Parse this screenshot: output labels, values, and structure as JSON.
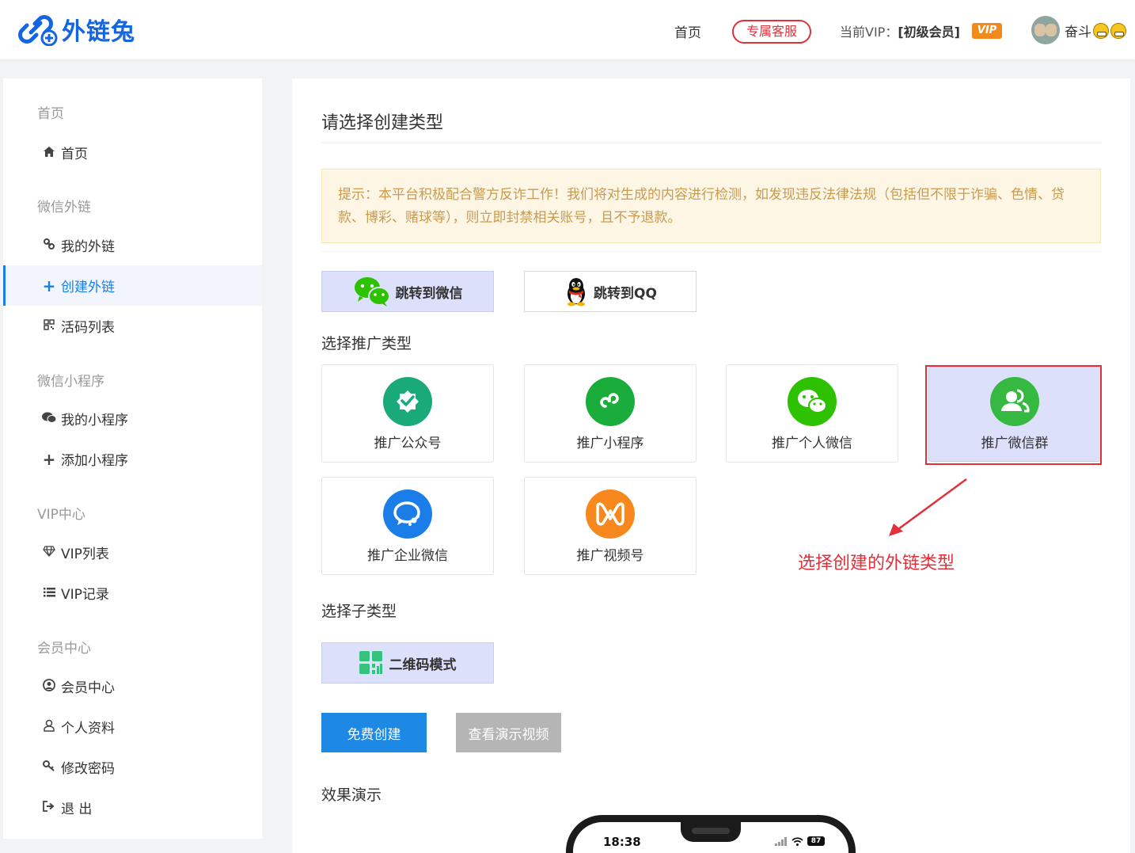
{
  "header": {
    "logo_text": "外链兔",
    "nav_home": "首页",
    "nav_service": "专属客服",
    "vip_label": "当前VIP：",
    "vip_level": "[初级会员]",
    "vip_badge": "VIP",
    "username": "奋斗"
  },
  "sidebar": {
    "groups": [
      {
        "title": "首页",
        "items": [
          {
            "label": "首页",
            "icon": "home-icon"
          }
        ]
      },
      {
        "title": "微信外链",
        "items": [
          {
            "label": "我的外链",
            "icon": "link-icon"
          },
          {
            "label": "创建外链",
            "icon": "plus-icon",
            "active": true
          },
          {
            "label": "活码列表",
            "icon": "qrcode-icon"
          }
        ]
      },
      {
        "title": "微信小程序",
        "items": [
          {
            "label": "我的小程序",
            "icon": "wechat-icon"
          },
          {
            "label": "添加小程序",
            "icon": "plus-icon"
          }
        ]
      },
      {
        "title": "VIP中心",
        "items": [
          {
            "label": "VIP列表",
            "icon": "diamond-icon"
          },
          {
            "label": "VIP记录",
            "icon": "list-icon"
          }
        ]
      },
      {
        "title": "会员中心",
        "items": [
          {
            "label": "会员中心",
            "icon": "user-circle-icon"
          },
          {
            "label": "个人资料",
            "icon": "user-icon"
          },
          {
            "label": "修改密码",
            "icon": "key-icon"
          },
          {
            "label": "退 出",
            "icon": "signout-icon"
          }
        ]
      }
    ]
  },
  "main": {
    "title": "请选择创建类型",
    "notice": "提示：本平台积极配合警方反诈工作！我们将对生成的内容进行检测，如发现违反法律法规（包括但不限于诈骗、色情、贷款、博彩、赌球等），则立即封禁相关账号，且不予退款。",
    "jump_wechat": "跳转到微信",
    "jump_qq": "跳转到QQ",
    "promo_type_label": "选择推广类型",
    "promo_types": [
      {
        "label": "推广公众号",
        "icon": "official-account-icon",
        "color": "#1aaa7a"
      },
      {
        "label": "推广小程序",
        "icon": "miniprogram-icon",
        "color": "#1aad3c"
      },
      {
        "label": "推广个人微信",
        "icon": "wechat-personal-icon",
        "color": "#2dc100"
      },
      {
        "label": "推广微信群",
        "icon": "wechat-group-icon",
        "color": "#35b940",
        "selected": true
      },
      {
        "label": "推广企业微信",
        "icon": "work-wechat-icon",
        "color": "#1a7de8"
      },
      {
        "label": "推广视频号",
        "icon": "channels-icon",
        "color": "#f7881e"
      }
    ],
    "annotation": "选择创建的外链类型",
    "subtype_label": "选择子类型",
    "subtype_qr": "二维码模式",
    "btn_create": "免费创建",
    "btn_demo": "查看演示视频",
    "effect_label": "效果演示",
    "phone_time": "18:38",
    "phone_battery": "87"
  }
}
